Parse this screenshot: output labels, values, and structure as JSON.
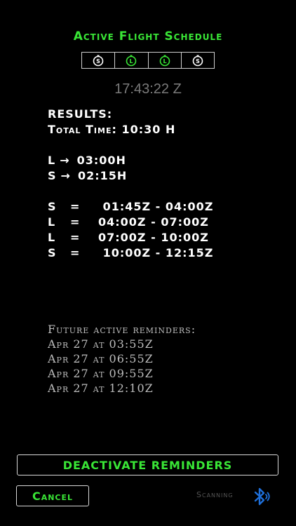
{
  "header": {
    "title": "Active Flight Schedule",
    "segments": [
      {
        "label": "S",
        "color": "#ffffff"
      },
      {
        "label": "L",
        "color": "#39e636"
      },
      {
        "label": "L",
        "color": "#39e636"
      },
      {
        "label": "S",
        "color": "#ffffff"
      }
    ],
    "clock": "17:43:22 Z"
  },
  "results": {
    "heading": "RESULTS:",
    "total_time": "Total Time: 10:30 H",
    "durations": [
      {
        "key": "L",
        "arrow": "→",
        "value": "03:00H"
      },
      {
        "key": "S",
        "arrow": "→",
        "value": "02:15H"
      }
    ],
    "schedule": [
      {
        "key": "S",
        "eq": "=",
        "range": " 01:45Z - 04:00Z"
      },
      {
        "key": "L",
        "eq": "=",
        "range": "04:00Z - 07:00Z"
      },
      {
        "key": "L",
        "eq": "=",
        "range": "07:00Z - 10:00Z"
      },
      {
        "key": "S",
        "eq": "=",
        "range": " 10:00Z - 12:15Z"
      }
    ]
  },
  "reminders": {
    "heading": "Future active reminders:",
    "items": [
      "Apr 27 at 03:55Z",
      "Apr 27 at 06:55Z",
      "Apr 27 at 09:55Z",
      "Apr 27 at 12:10Z"
    ]
  },
  "buttons": {
    "deactivate": "DEACTIVATE REMINDERS",
    "cancel": "Cancel"
  },
  "status": {
    "scanning": "Scanning",
    "bluetooth_icon": "bluetooth-icon",
    "accent": "#39e636",
    "bluetooth_color": "#1e6fd9"
  }
}
